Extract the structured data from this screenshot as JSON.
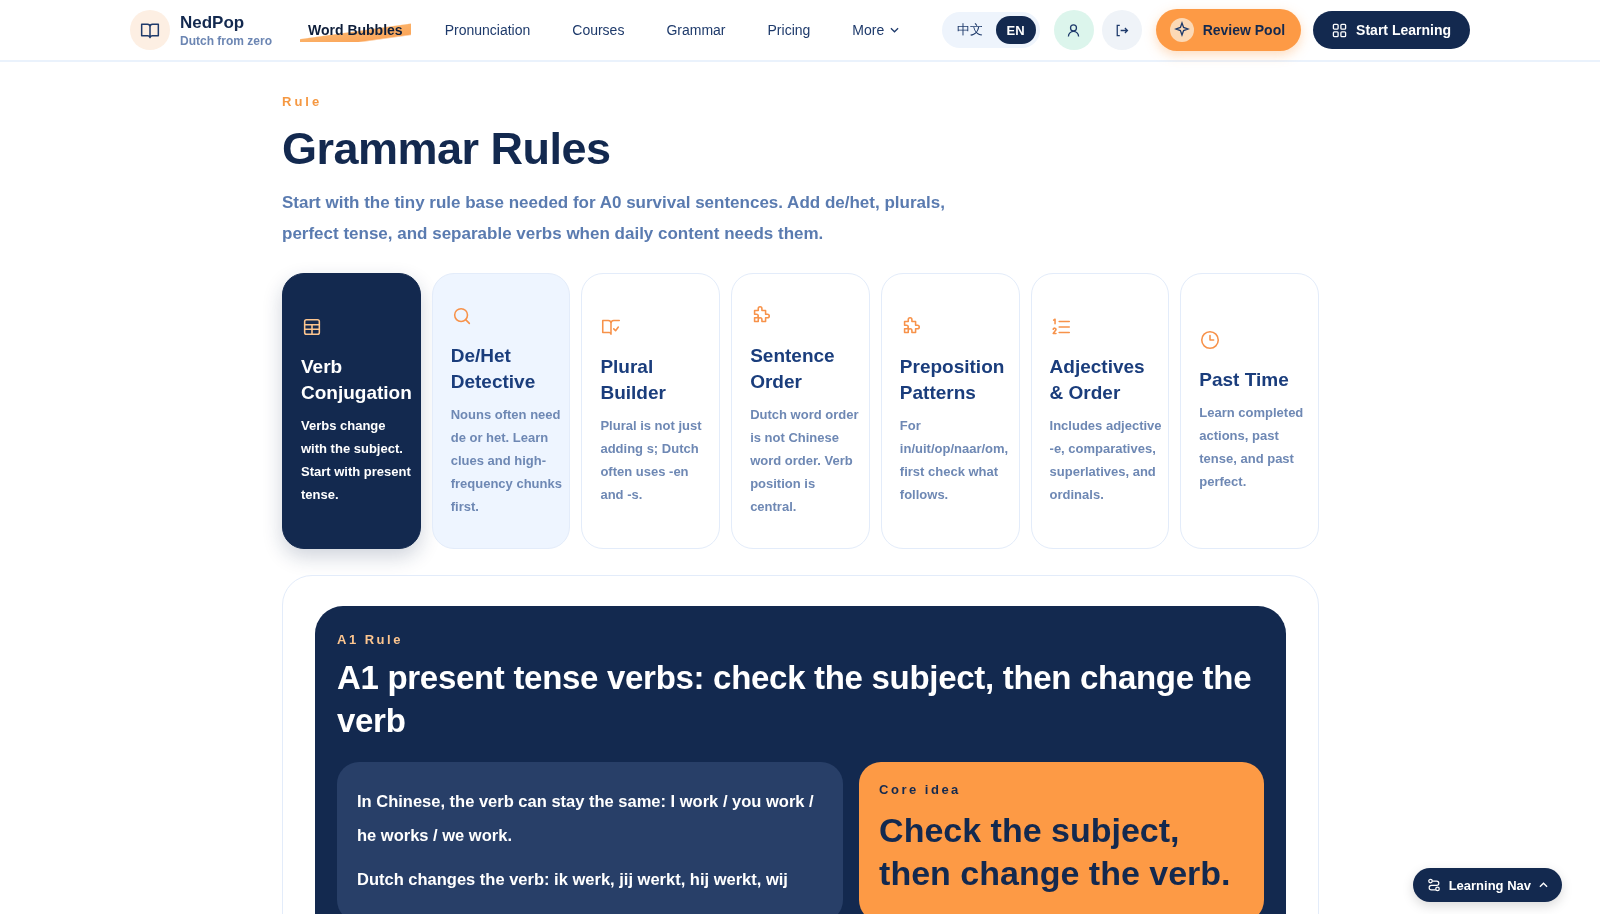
{
  "brand": {
    "name": "NedPop",
    "tagline": "Dutch from zero"
  },
  "nav": [
    {
      "label": "Word Bubbles",
      "selected": true
    },
    {
      "label": "Pronunciation",
      "selected": false
    },
    {
      "label": "Courses",
      "selected": false
    },
    {
      "label": "Grammar",
      "selected": false
    },
    {
      "label": "Pricing",
      "selected": false
    },
    {
      "label": "More",
      "selected": false
    }
  ],
  "languages": [
    {
      "label": "中文",
      "selected": false
    },
    {
      "label": "EN",
      "selected": true
    }
  ],
  "actions": {
    "review": "Review Pool",
    "start": "Start Learning"
  },
  "header": {
    "eyebrow": "Rule",
    "title": "Grammar Rules",
    "intro": "Start with the tiny rule base needed for A0 survival sentences. Add de/het, plurals, perfect tense, and separable verbs when daily content needs them."
  },
  "rules": [
    {
      "title": "Verb Conjugation",
      "text": "Verbs change with the subject. Start with present tense.",
      "selected": true,
      "highlighted": false
    },
    {
      "title": "De/Het Detective",
      "text": "Nouns often need de or het. Learn clues and high-frequency chunks first.",
      "selected": false,
      "highlighted": true
    },
    {
      "title": "Plural Builder",
      "text": "Plural is not just adding s; Dutch often uses -en and -s.",
      "selected": false,
      "highlighted": false
    },
    {
      "title": "Sentence Order",
      "text": "Dutch word order is not Chinese word order. Verb position is central.",
      "selected": false,
      "highlighted": false
    },
    {
      "title": "Preposition Patterns",
      "text": "For in/uit/op/naar/om, first check what follows.",
      "selected": false,
      "highlighted": false
    },
    {
      "title": "Adjectives & Order",
      "text": "Includes adjective -e, comparatives, superlatives, and ordinals.",
      "selected": false,
      "highlighted": false
    },
    {
      "title": "Past Time",
      "text": "Learn completed actions, past tense, and past perfect.",
      "selected": false,
      "highlighted": false
    }
  ],
  "detail": {
    "eyebrow": "A1 Rule",
    "title": "A1 present tense verbs: check the subject, then change the verb",
    "paragraphs": [
      "In Chinese, the verb can stay the same: I work / you work / he works / we work.",
      "Dutch changes the verb: ik werk, jij werkt, hij werkt, wij"
    ],
    "core": {
      "label": "Core idea",
      "text": "Check the subject, then change the verb."
    }
  },
  "floating": {
    "label": "Learning Nav"
  }
}
